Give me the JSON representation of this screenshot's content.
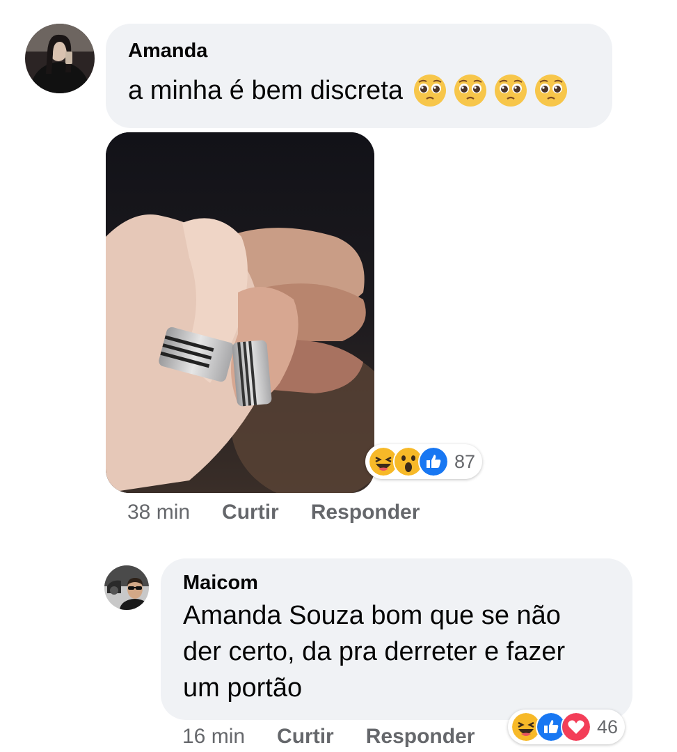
{
  "comments": [
    {
      "author": "Amanda",
      "text": "a minha é bem discreta",
      "emoji_icons": [
        "pleading-face-icon",
        "pleading-face-icon",
        "pleading-face-icon",
        "pleading-face-icon"
      ],
      "reactions": {
        "icons": [
          "laughing-icon",
          "wow-icon",
          "like-icon"
        ],
        "count": "87"
      },
      "time": "38 min",
      "like_label": "Curtir",
      "reply_label": "Responder"
    },
    {
      "author": "Maicom",
      "text_lines": [
        "Amanda Souza bom que se não",
        "der certo, da pra derreter e fazer",
        "um portão"
      ],
      "reactions": {
        "icons": [
          "laughing-icon",
          "like-icon",
          "love-icon"
        ],
        "count": "46"
      },
      "time": "16 min",
      "like_label": "Curtir",
      "reply_label": "Responder"
    }
  ],
  "colors": {
    "bubble": "#f0f2f5",
    "meta_text": "#65676b",
    "like_blue": "#1877f2",
    "love_red": "#f33e58",
    "emoji_yellow": "#f7b928"
  }
}
